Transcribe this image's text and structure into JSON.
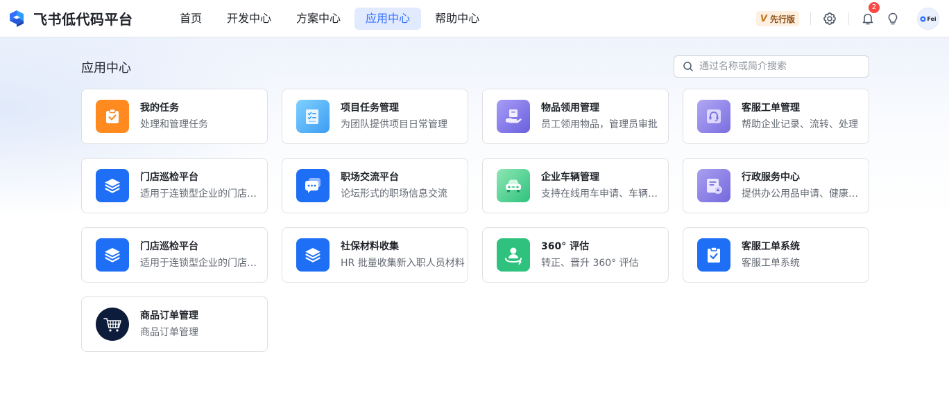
{
  "header": {
    "brand_name": "飞书低代码平台",
    "nav": [
      {
        "label": "首页",
        "active": false
      },
      {
        "label": "开发中心",
        "active": false
      },
      {
        "label": "方案中心",
        "active": false
      },
      {
        "label": "应用中心",
        "active": true
      },
      {
        "label": "帮助中心",
        "active": false
      }
    ],
    "version_badge": "先行版",
    "version_badge_mark": "V",
    "notification_count": "2",
    "avatar_text": "Fei"
  },
  "main": {
    "title": "应用中心",
    "search_placeholder": "通过名称或简介搜索",
    "search_value": "",
    "apps": [
      {
        "title": "我的任务",
        "desc": "处理和管理任务",
        "icon": "clipboard-check-icon",
        "color": "#ff8a1f"
      },
      {
        "title": "项目任务管理",
        "desc": "为团队提供项目日常管理",
        "icon": "task-document-icon",
        "color": "#4fb4f6"
      },
      {
        "title": "物品领用管理",
        "desc": "员工领用物品，管理员审批",
        "icon": "hand-package-icon",
        "color": "#7b74e6"
      },
      {
        "title": "客服工单管理",
        "desc": "帮助企业记录、流转、处理",
        "icon": "headset-icon",
        "color": "#8a7ee0"
      },
      {
        "title": "门店巡检平台",
        "desc": "适用于连锁型企业的门店巡检",
        "icon": "layers-icon",
        "color": "#1e6ff5"
      },
      {
        "title": "职场交流平台",
        "desc": "论坛形式的职场信息交流",
        "icon": "chat-bubble-icon",
        "color": "#1e6ff5"
      },
      {
        "title": "企业车辆管理",
        "desc": "支持在线用车申请、车辆管理",
        "icon": "car-icon",
        "color": "#2ec27e"
      },
      {
        "title": "行政服务中心",
        "desc": "提供办公用品申请、健康上报",
        "icon": "admin-service-icon",
        "color": "#8a7ee0"
      },
      {
        "title": "门店巡检平台",
        "desc": "适用于连锁型企业的门店巡检",
        "icon": "layers-icon",
        "color": "#1e6ff5"
      },
      {
        "title": "社保材料收集",
        "desc": "HR 批量收集新入职人员材料",
        "icon": "layers-icon",
        "color": "#1e6ff5"
      },
      {
        "title": "360° 评估",
        "desc": "转正、晋升 360° 评估",
        "icon": "person-rotate-icon",
        "color": "#2ec27e"
      },
      {
        "title": "客服工单系统",
        "desc": "客服工单系统",
        "icon": "clipboard-check-icon",
        "color": "#1e6ff5"
      },
      {
        "title": "商品订单管理",
        "desc": "商品订单管理",
        "icon": "shopping-cart-icon",
        "color": "#0e1c3b"
      }
    ]
  }
}
